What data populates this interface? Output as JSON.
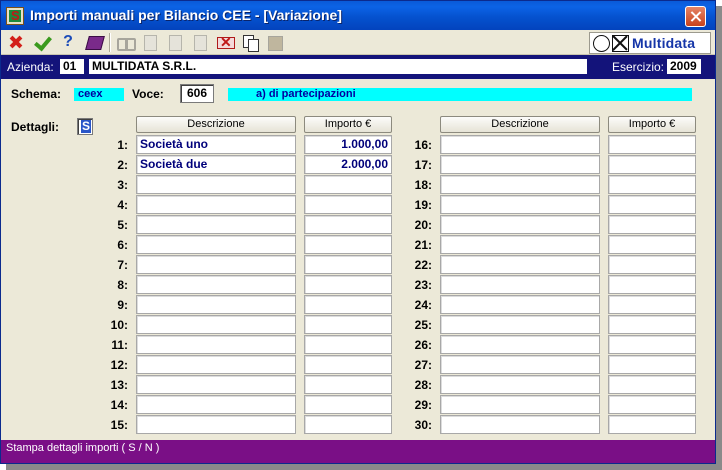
{
  "window": {
    "title": "Importi manuali per Bilancio CEE - [Variazione]"
  },
  "brand": {
    "name": "Multidata"
  },
  "company": {
    "azienda_label": "Azienda:",
    "azienda_code": "01",
    "azienda_name": "MULTIDATA S.R.L.",
    "esercizio_label": "Esercizio:",
    "esercizio_value": "2009"
  },
  "schema": {
    "schema_label": "Schema:",
    "schema_value": "ceex",
    "voce_label": "Voce:",
    "voce_value": "606",
    "voce_description": "a) di partecipazioni"
  },
  "details": {
    "label": "Dettagli:",
    "value": "S"
  },
  "table": {
    "col_descrizione": "Descrizione",
    "col_importo": "Importo €",
    "rows": [
      {
        "num": "1:",
        "desc": "Società uno",
        "amount": "1.000,00"
      },
      {
        "num": "2:",
        "desc": "Società due",
        "amount": "2.000,00"
      },
      {
        "num": "3:",
        "desc": "",
        "amount": ""
      },
      {
        "num": "4:",
        "desc": "",
        "amount": ""
      },
      {
        "num": "5:",
        "desc": "",
        "amount": ""
      },
      {
        "num": "6:",
        "desc": "",
        "amount": ""
      },
      {
        "num": "7:",
        "desc": "",
        "amount": ""
      },
      {
        "num": "8:",
        "desc": "",
        "amount": ""
      },
      {
        "num": "9:",
        "desc": "",
        "amount": ""
      },
      {
        "num": "10:",
        "desc": "",
        "amount": ""
      },
      {
        "num": "11:",
        "desc": "",
        "amount": ""
      },
      {
        "num": "12:",
        "desc": "",
        "amount": ""
      },
      {
        "num": "13:",
        "desc": "",
        "amount": ""
      },
      {
        "num": "14:",
        "desc": "",
        "amount": ""
      },
      {
        "num": "15:",
        "desc": "",
        "amount": ""
      },
      {
        "num": "16:",
        "desc": "",
        "amount": ""
      },
      {
        "num": "17:",
        "desc": "",
        "amount": ""
      },
      {
        "num": "18:",
        "desc": "",
        "amount": ""
      },
      {
        "num": "19:",
        "desc": "",
        "amount": ""
      },
      {
        "num": "20:",
        "desc": "",
        "amount": ""
      },
      {
        "num": "21:",
        "desc": "",
        "amount": ""
      },
      {
        "num": "22:",
        "desc": "",
        "amount": ""
      },
      {
        "num": "23:",
        "desc": "",
        "amount": ""
      },
      {
        "num": "24:",
        "desc": "",
        "amount": ""
      },
      {
        "num": "25:",
        "desc": "",
        "amount": ""
      },
      {
        "num": "26:",
        "desc": "",
        "amount": ""
      },
      {
        "num": "27:",
        "desc": "",
        "amount": ""
      },
      {
        "num": "28:",
        "desc": "",
        "amount": ""
      },
      {
        "num": "29:",
        "desc": "",
        "amount": ""
      },
      {
        "num": "30:",
        "desc": "",
        "amount": ""
      }
    ]
  },
  "status": {
    "text": "Stampa dettagli importi ( S / N )"
  },
  "colors": {
    "titlebar": "#0552cf",
    "company_bar": "#13137a",
    "highlight": "#00ffff",
    "status_bar": "#7a0f86",
    "value_text": "#00007a"
  },
  "icons": [
    "app-icon",
    "close-icon",
    "cancel-icon",
    "confirm-icon",
    "help-icon",
    "book-icon",
    "binoculars-icon",
    "document-icon",
    "delete-icon",
    "copy-icon",
    "paste-icon"
  ]
}
